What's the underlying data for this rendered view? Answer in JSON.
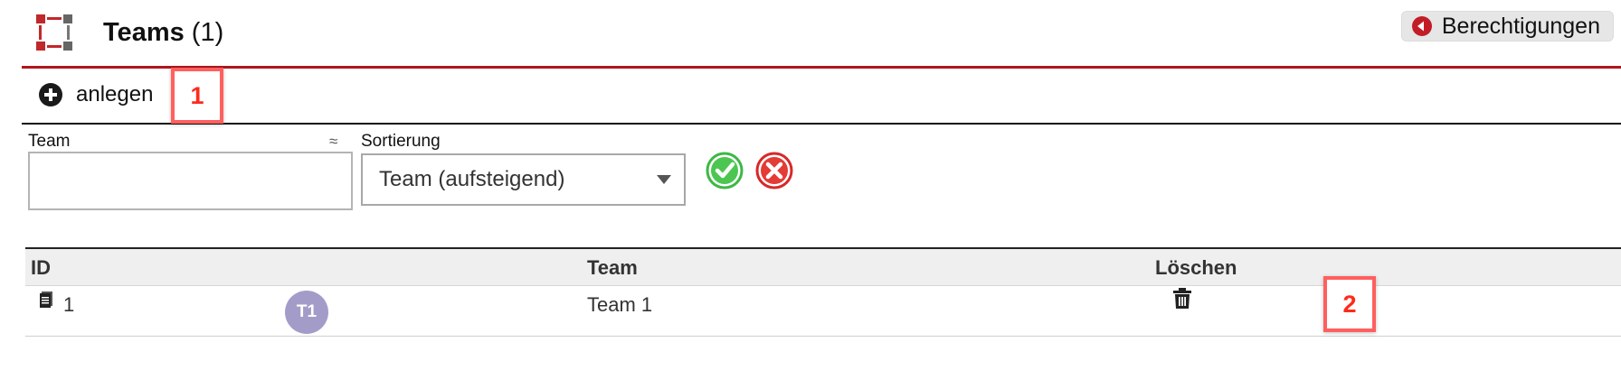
{
  "header": {
    "title": "Teams",
    "count": "(1)",
    "permissions_label": "Berechtigungen"
  },
  "toolbar": {
    "create_label": "anlegen"
  },
  "filter": {
    "team_label": "Team",
    "team_match_symbol": "≈",
    "team_value": "",
    "sort_label": "Sortierung",
    "sort_value": "Team (aufsteigend)"
  },
  "table": {
    "headers": [
      "ID",
      "Team",
      "Löschen"
    ],
    "rows": [
      {
        "id": "1",
        "avatar": "T1",
        "team": "Team 1"
      }
    ]
  },
  "annotations": [
    "1",
    "2"
  ],
  "colors": {
    "accent_red": "#b0161d",
    "confirm_green": "#3cb844",
    "cancel_red": "#d8282a",
    "avatar_purple": "#a49cc8",
    "marker_red": "#ff2a1a"
  },
  "icons": [
    "app-logo-icon",
    "back-arrow-icon",
    "plus-circle-icon",
    "checkmark-icon",
    "close-x-icon",
    "document-icon",
    "trash-icon"
  ]
}
